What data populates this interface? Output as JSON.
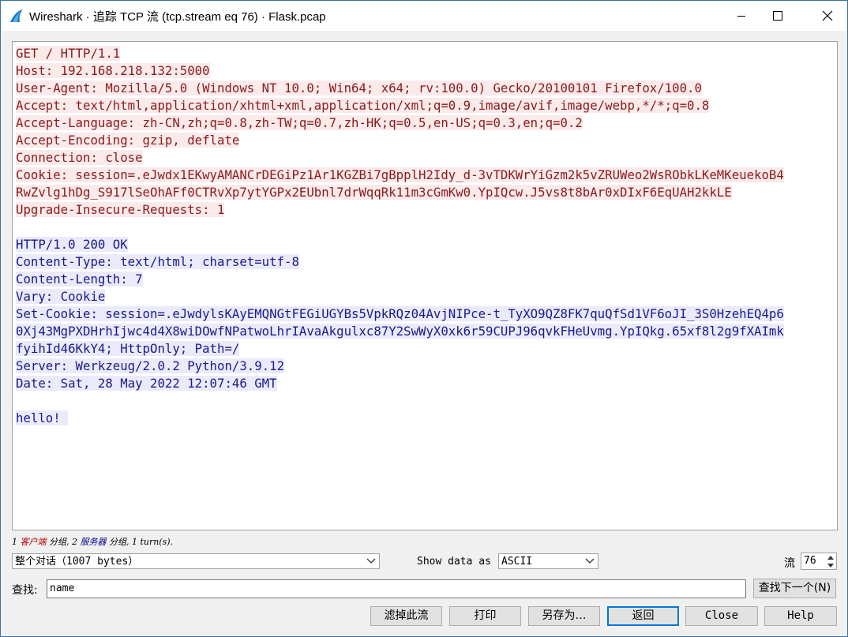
{
  "window": {
    "title": "Wireshark · 追踪 TCP 流 (tcp.stream eq 76) · Flask.pcap"
  },
  "stream": {
    "client_lines": [
      "GET / HTTP/1.1",
      "Host: 192.168.218.132:5000",
      "User-Agent: Mozilla/5.0 (Windows NT 10.0; Win64; x64; rv:100.0) Gecko/20100101 Firefox/100.0",
      "Accept: text/html,application/xhtml+xml,application/xml;q=0.9,image/avif,image/webp,*/*;q=0.8",
      "Accept-Language: zh-CN,zh;q=0.8,zh-TW;q=0.7,zh-HK;q=0.5,en-US;q=0.3,en;q=0.2",
      "Accept-Encoding: gzip, deflate",
      "Connection: close",
      "Cookie: session=.eJwdx1EKwyAMANCrDEGiPz1Ar1KGZBi7gBpplH2Idy_d-3vTDKWrYiGzm2k5vZRUWeo2WsRObkLKeMKeuekoB4",
      "RwZvlg1hDg_S917lSeOhAFf0CTRvXp7ytYGPx2EUbnl7drWqqRk11m3cGmKw0.YpIQcw.J5vs8t8bAr0xDIxF6EqUAH2kkLE",
      "Upgrade-Insecure-Requests: 1"
    ],
    "server_lines": [
      "HTTP/1.0 200 OK",
      "Content-Type: text/html; charset=utf-8",
      "Content-Length: 7",
      "Vary: Cookie",
      "Set-Cookie: session=.eJwdylsKAyEMQNGtFEGiUGYBs5VpkRQz04AvjNIPce-t_TyXO9QZ8FK7quQfSd1VF6oJI_3S0HzehEQ4p6",
      "0Xj43MgPXDHrhIjwc4d4X8wiDOwfNPatwoLhrIAvaAkgulxc87Y2SwWyX0xk6r59CUPJ96qvkFHeUvmg.YpIQkg.65xf8l2g9fXAImk",
      "fyihId46KkY4; HttpOnly; Path=/",
      "Server: Werkzeug/2.0.2 Python/3.9.12",
      "Date: Sat, 28 May 2022 12:07:46 GMT"
    ],
    "body_lines": [
      "hello! "
    ]
  },
  "summary": {
    "prefix": "1 ",
    "client_label": "客户端",
    "middle": " 分组, 2 ",
    "server_label": "服务器",
    "suffix": " 分组, 1 turn(s)."
  },
  "controls": {
    "conversation_select": "整个对话（1007 bytes）",
    "show_data_label": "Show data as",
    "show_data_value": "ASCII",
    "stream_label": "流",
    "stream_number": "76",
    "find_label": "查找:",
    "find_value": "name",
    "find_next": "查找下一个(N)"
  },
  "buttons": {
    "filter_out": "滤掉此流",
    "print": "打印",
    "save_as": "另存为…",
    "back": "返回",
    "close": "Close",
    "help": "Help"
  },
  "colors": {
    "client_fg": "#8b1a1a",
    "client_bg": "#faeaea",
    "server_fg": "#1a1a8b",
    "server_bg": "#eaeafa"
  }
}
